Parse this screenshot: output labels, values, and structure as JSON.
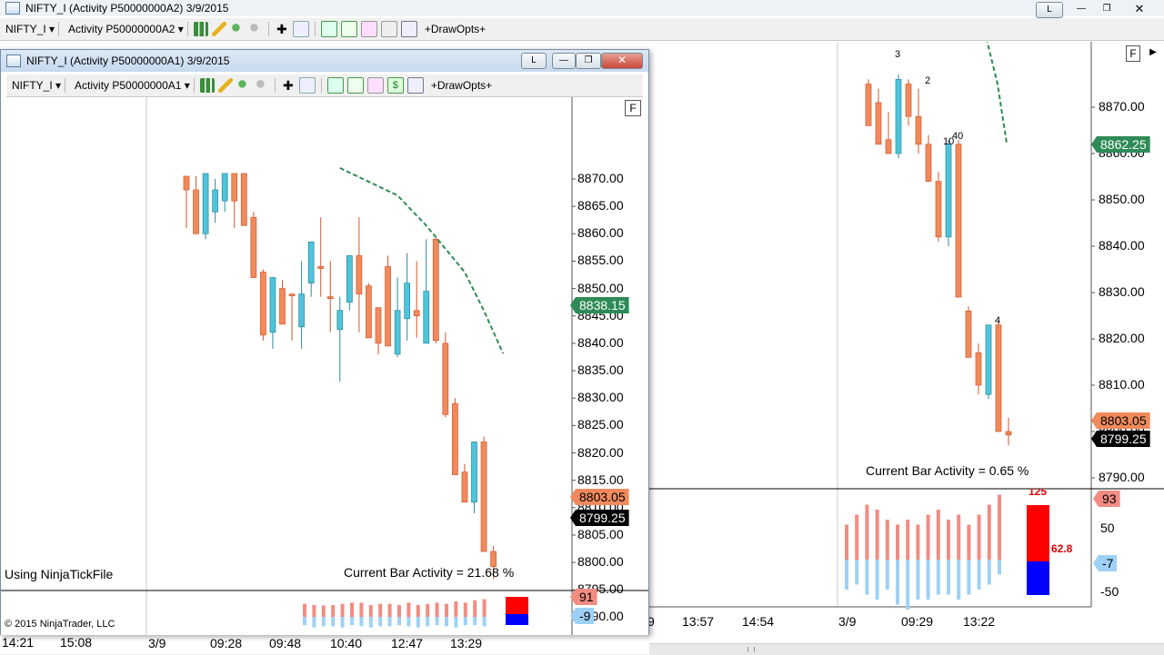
{
  "back_window": {
    "title": "NIFTY_I (Activity P50000000A2)  3/9/2015",
    "toolbar": {
      "instrument": "NIFTY_I",
      "activity": "Activity P50000000A2",
      "drawopts": "+DrawOpts+"
    },
    "corner_btn": "F",
    "link_btn": "L",
    "y_ticks": [
      "8870.00",
      "8860.00",
      "8850.00",
      "8840.00",
      "8830.00",
      "8820.00",
      "8810.00",
      "8800.00",
      "8790.00"
    ],
    "price_flags": {
      "sma": "8862.25",
      "high": "8803.05",
      "last": "8799.25"
    },
    "bar_numbers": [
      "3",
      "2",
      "10",
      "40",
      "4"
    ],
    "activity_text": "Current Bar Activity = 0.65 %",
    "sub_ticks": [
      "50",
      "-50"
    ],
    "sub_flags": {
      "pos": "93",
      "neg": "-7"
    },
    "sub_values": {
      "top": "125",
      "mid": "62.8"
    },
    "x_ticks": [
      "13:57",
      "14:54",
      "3/9",
      "09:29",
      "13:22"
    ],
    "x_left_partial": "9"
  },
  "front_window": {
    "title": "NIFTY_I (Activity P50000000A1)  3/9/2015",
    "toolbar": {
      "instrument": "NIFTY_I",
      "activity": "Activity P50000000A1",
      "drawopts": "+DrawOpts+"
    },
    "corner_btn": "F",
    "link_btn": "L",
    "y_ticks": [
      "8870.00",
      "8865.00",
      "8860.00",
      "8855.00",
      "8850.00",
      "8845.00",
      "8840.00",
      "8835.00",
      "8830.00",
      "8825.00",
      "8820.00",
      "8815.00",
      "8810.00",
      "8805.00",
      "8800.00",
      "8795.00",
      "8790.00"
    ],
    "price_flags": {
      "sma": "8838.15",
      "high": "8803.05",
      "last": "8799.25"
    },
    "ninja_text": "Using NinjaTickFile",
    "activity_text": "Current Bar Activity = 21.68 %",
    "sub_flags": {
      "pos": "91",
      "neg": "-9"
    },
    "copyright": "© 2015 NinjaTrader, LLC",
    "x_ticks": [
      "3/9",
      "09:28",
      "09:48",
      "10:40",
      "12:47",
      "13:29"
    ]
  },
  "bottom_axis": {
    "ticks": [
      "14:21",
      "15:08"
    ]
  },
  "colors": {
    "up": "#4fc3d9",
    "down": "#f08a5d",
    "down_edge": "#d2562a",
    "sma": "#2e8b57",
    "pos_hist": "#f28c82",
    "neg_hist": "#9ed1f5"
  },
  "chart_data": {
    "type": "candlestick",
    "front_candles": [
      {
        "o": 8868.0,
        "h": 8870.5,
        "l": 8861.0,
        "c": 8870.5,
        "up": false
      },
      {
        "o": 8868.0,
        "h": 8870.5,
        "l": 8860.0,
        "c": 8860.0,
        "up": false
      },
      {
        "o": 8860.0,
        "h": 8871.0,
        "l": 8859.0,
        "c": 8871.0,
        "up": true
      },
      {
        "o": 8864.0,
        "h": 8870.0,
        "l": 8862.0,
        "c": 8868.0,
        "up": true
      },
      {
        "o": 8866.0,
        "h": 8871.0,
        "l": 8864.0,
        "c": 8871.0,
        "up": true
      },
      {
        "o": 8871.0,
        "h": 8870.5,
        "l": 8861.0,
        "c": 8866.0,
        "up": false
      },
      {
        "o": 8871.0,
        "h": 8870.5,
        "l": 8861.5,
        "c": 8861.5,
        "up": false
      },
      {
        "o": 8863.0,
        "h": 8864.0,
        "l": 8852.0,
        "c": 8852.0,
        "up": false
      },
      {
        "o": 8853.0,
        "h": 8853.5,
        "l": 8840.5,
        "c": 8841.5,
        "up": false
      },
      {
        "o": 8842.0,
        "h": 8852.0,
        "l": 8839.0,
        "c": 8852.0,
        "up": true
      },
      {
        "o": 8850.0,
        "h": 8851.5,
        "l": 8843.5,
        "c": 8843.5,
        "up": false
      },
      {
        "o": 8849.0,
        "h": 8849.0,
        "l": 8840.5,
        "c": 8849.0,
        "up": false
      },
      {
        "o": 8843.0,
        "h": 8855.0,
        "l": 8839.0,
        "c": 8849.0,
        "up": true
      },
      {
        "o": 8851.0,
        "h": 8858.5,
        "l": 8848.5,
        "c": 8858.5,
        "up": true
      },
      {
        "o": 8854.0,
        "h": 8863.0,
        "l": 8848.5,
        "c": 8854.0,
        "up": false
      },
      {
        "o": 8848.5,
        "h": 8855.0,
        "l": 8842.0,
        "c": 8848.5,
        "up": false
      },
      {
        "o": 8846.0,
        "h": 8848.5,
        "l": 8833.0,
        "c": 8842.5,
        "up": true
      },
      {
        "o": 8847.5,
        "h": 8856.0,
        "l": 8846.0,
        "c": 8856.0,
        "up": true
      },
      {
        "o": 8856.0,
        "h": 8863.0,
        "l": 8842.0,
        "c": 8849.0,
        "up": false
      },
      {
        "o": 8850.5,
        "h": 8851.0,
        "l": 8841.0,
        "c": 8841.0,
        "up": false
      },
      {
        "o": 8846.5,
        "h": 8846.5,
        "l": 8838.0,
        "c": 8840.0,
        "up": false
      },
      {
        "o": 8854.0,
        "h": 8856.0,
        "l": 8839.5,
        "c": 8839.5,
        "up": false
      },
      {
        "o": 8846.0,
        "h": 8852.0,
        "l": 8837.5,
        "c": 8838.0,
        "up": true
      },
      {
        "o": 8844.5,
        "h": 8856.5,
        "l": 8840.5,
        "c": 8851.0,
        "up": true
      },
      {
        "o": 8846.0,
        "h": 8855.0,
        "l": 8841.0,
        "c": 8845.0,
        "up": false
      },
      {
        "o": 8849.5,
        "h": 8859.0,
        "l": 8840.0,
        "c": 8840.0,
        "up": true
      },
      {
        "o": 8859.0,
        "h": 8859.5,
        "l": 8840.0,
        "c": 8840.5,
        "up": false
      },
      {
        "o": 8840.0,
        "h": 8842.0,
        "l": 8826.5,
        "c": 8827.0,
        "up": false
      },
      {
        "o": 8829.0,
        "h": 8830.0,
        "l": 8816.0,
        "c": 8816.0,
        "up": false
      },
      {
        "o": 8816.5,
        "h": 8818.0,
        "l": 8811.0,
        "c": 8811.0,
        "up": false
      },
      {
        "o": 8811.0,
        "h": 8822.0,
        "l": 8809.0,
        "c": 8822.0,
        "up": true
      },
      {
        "o": 8822.0,
        "h": 8823.0,
        "l": 8802.0,
        "c": 8802.0,
        "up": false
      },
      {
        "o": 8802.0,
        "h": 8803.0,
        "l": 8797.0,
        "c": 8799.25,
        "up": false
      }
    ],
    "front_sma": [
      [
        8872.0,
        0
      ],
      [
        8867.0,
        6
      ],
      [
        8861.5,
        9
      ],
      [
        8853.0,
        13
      ],
      [
        8846.0,
        15
      ],
      [
        8838.15,
        17
      ]
    ],
    "front_activity": [
      {
        "pos": 0.55,
        "neg": 0.35
      },
      {
        "pos": 0.5,
        "neg": 0.45
      },
      {
        "pos": 0.48,
        "neg": 0.4
      },
      {
        "pos": 0.5,
        "neg": 0.4
      },
      {
        "pos": 0.55,
        "neg": 0.45
      },
      {
        "pos": 0.6,
        "neg": 0.35
      },
      {
        "pos": 0.6,
        "neg": 0.4
      },
      {
        "pos": 0.5,
        "neg": 0.45
      },
      {
        "pos": 0.55,
        "neg": 0.4
      },
      {
        "pos": 0.55,
        "neg": 0.4
      },
      {
        "pos": 0.5,
        "neg": 0.35
      },
      {
        "pos": 0.6,
        "neg": 0.4
      },
      {
        "pos": 0.5,
        "neg": 0.45
      },
      {
        "pos": 0.55,
        "neg": 0.4
      },
      {
        "pos": 0.6,
        "neg": 0.35
      },
      {
        "pos": 0.55,
        "neg": 0.4
      },
      {
        "pos": 0.65,
        "neg": 0.45
      },
      {
        "pos": 0.6,
        "neg": 0.35
      },
      {
        "pos": 0.7,
        "neg": 0.35
      },
      {
        "pos": 0.75,
        "neg": 0.4
      }
    ],
    "back_candles": [
      {
        "o": 8875.0,
        "h": 8876.0,
        "l": 8866.0,
        "c": 8866.0,
        "up": false
      },
      {
        "o": 8871.0,
        "h": 8874.0,
        "l": 8862.0,
        "c": 8862.0,
        "up": false
      },
      {
        "o": 8863.0,
        "h": 8869.0,
        "l": 8860.0,
        "c": 8860.0,
        "up": false
      },
      {
        "o": 8860.0,
        "h": 8877.0,
        "l": 8859.0,
        "c": 8876.0,
        "up": true
      },
      {
        "o": 8875.0,
        "h": 8876.0,
        "l": 8866.0,
        "c": 8868.0,
        "up": false
      },
      {
        "o": 8868.0,
        "h": 8874.0,
        "l": 8860.0,
        "c": 8862.0,
        "up": false
      },
      {
        "o": 8862.0,
        "h": 8864.0,
        "l": 8854.0,
        "c": 8854.0,
        "up": false
      },
      {
        "o": 8854.0,
        "h": 8856.0,
        "l": 8841.0,
        "c": 8842.0,
        "up": false
      },
      {
        "o": 8842.0,
        "h": 8863.0,
        "l": 8840.0,
        "c": 8862.0,
        "up": true
      },
      {
        "o": 8862.0,
        "h": 8863.0,
        "l": 8829.0,
        "c": 8829.0,
        "up": false
      },
      {
        "o": 8826.0,
        "h": 8827.0,
        "l": 8816.0,
        "c": 8816.0,
        "up": false
      },
      {
        "o": 8817.0,
        "h": 8819.0,
        "l": 8808.0,
        "c": 8810.0,
        "up": false
      },
      {
        "o": 8808.0,
        "h": 8823.0,
        "l": 8807.0,
        "c": 8823.0,
        "up": true
      },
      {
        "o": 8823.0,
        "h": 8824.0,
        "l": 8800.0,
        "c": 8800.0,
        "up": false
      },
      {
        "o": 8800.0,
        "h": 8803.0,
        "l": 8797.0,
        "c": 8799.25,
        "up": false
      }
    ],
    "back_sma": [
      [
        8894.0,
        0
      ],
      [
        8883.0,
        3
      ],
      [
        8875.0,
        5
      ],
      [
        8862.25,
        7
      ]
    ],
    "back_activity": [
      {
        "pos": 0.35,
        "neg": 0.3
      },
      {
        "pos": 0.45,
        "neg": 0.25
      },
      {
        "pos": 0.55,
        "neg": 0.35
      },
      {
        "pos": 0.5,
        "neg": 0.4
      },
      {
        "pos": 0.4,
        "neg": 0.3
      },
      {
        "pos": 0.35,
        "neg": 0.45
      },
      {
        "pos": 0.4,
        "neg": 0.5
      },
      {
        "pos": 0.35,
        "neg": 0.4
      },
      {
        "pos": 0.45,
        "neg": 0.4
      },
      {
        "pos": 0.5,
        "neg": 0.35
      },
      {
        "pos": 0.4,
        "neg": 0.35
      },
      {
        "pos": 0.45,
        "neg": 0.4
      },
      {
        "pos": 0.35,
        "neg": 0.35
      },
      {
        "pos": 0.45,
        "neg": 0.3
      },
      {
        "pos": 0.55,
        "neg": 0.25
      },
      {
        "pos": 0.65,
        "neg": 0.15
      }
    ]
  }
}
